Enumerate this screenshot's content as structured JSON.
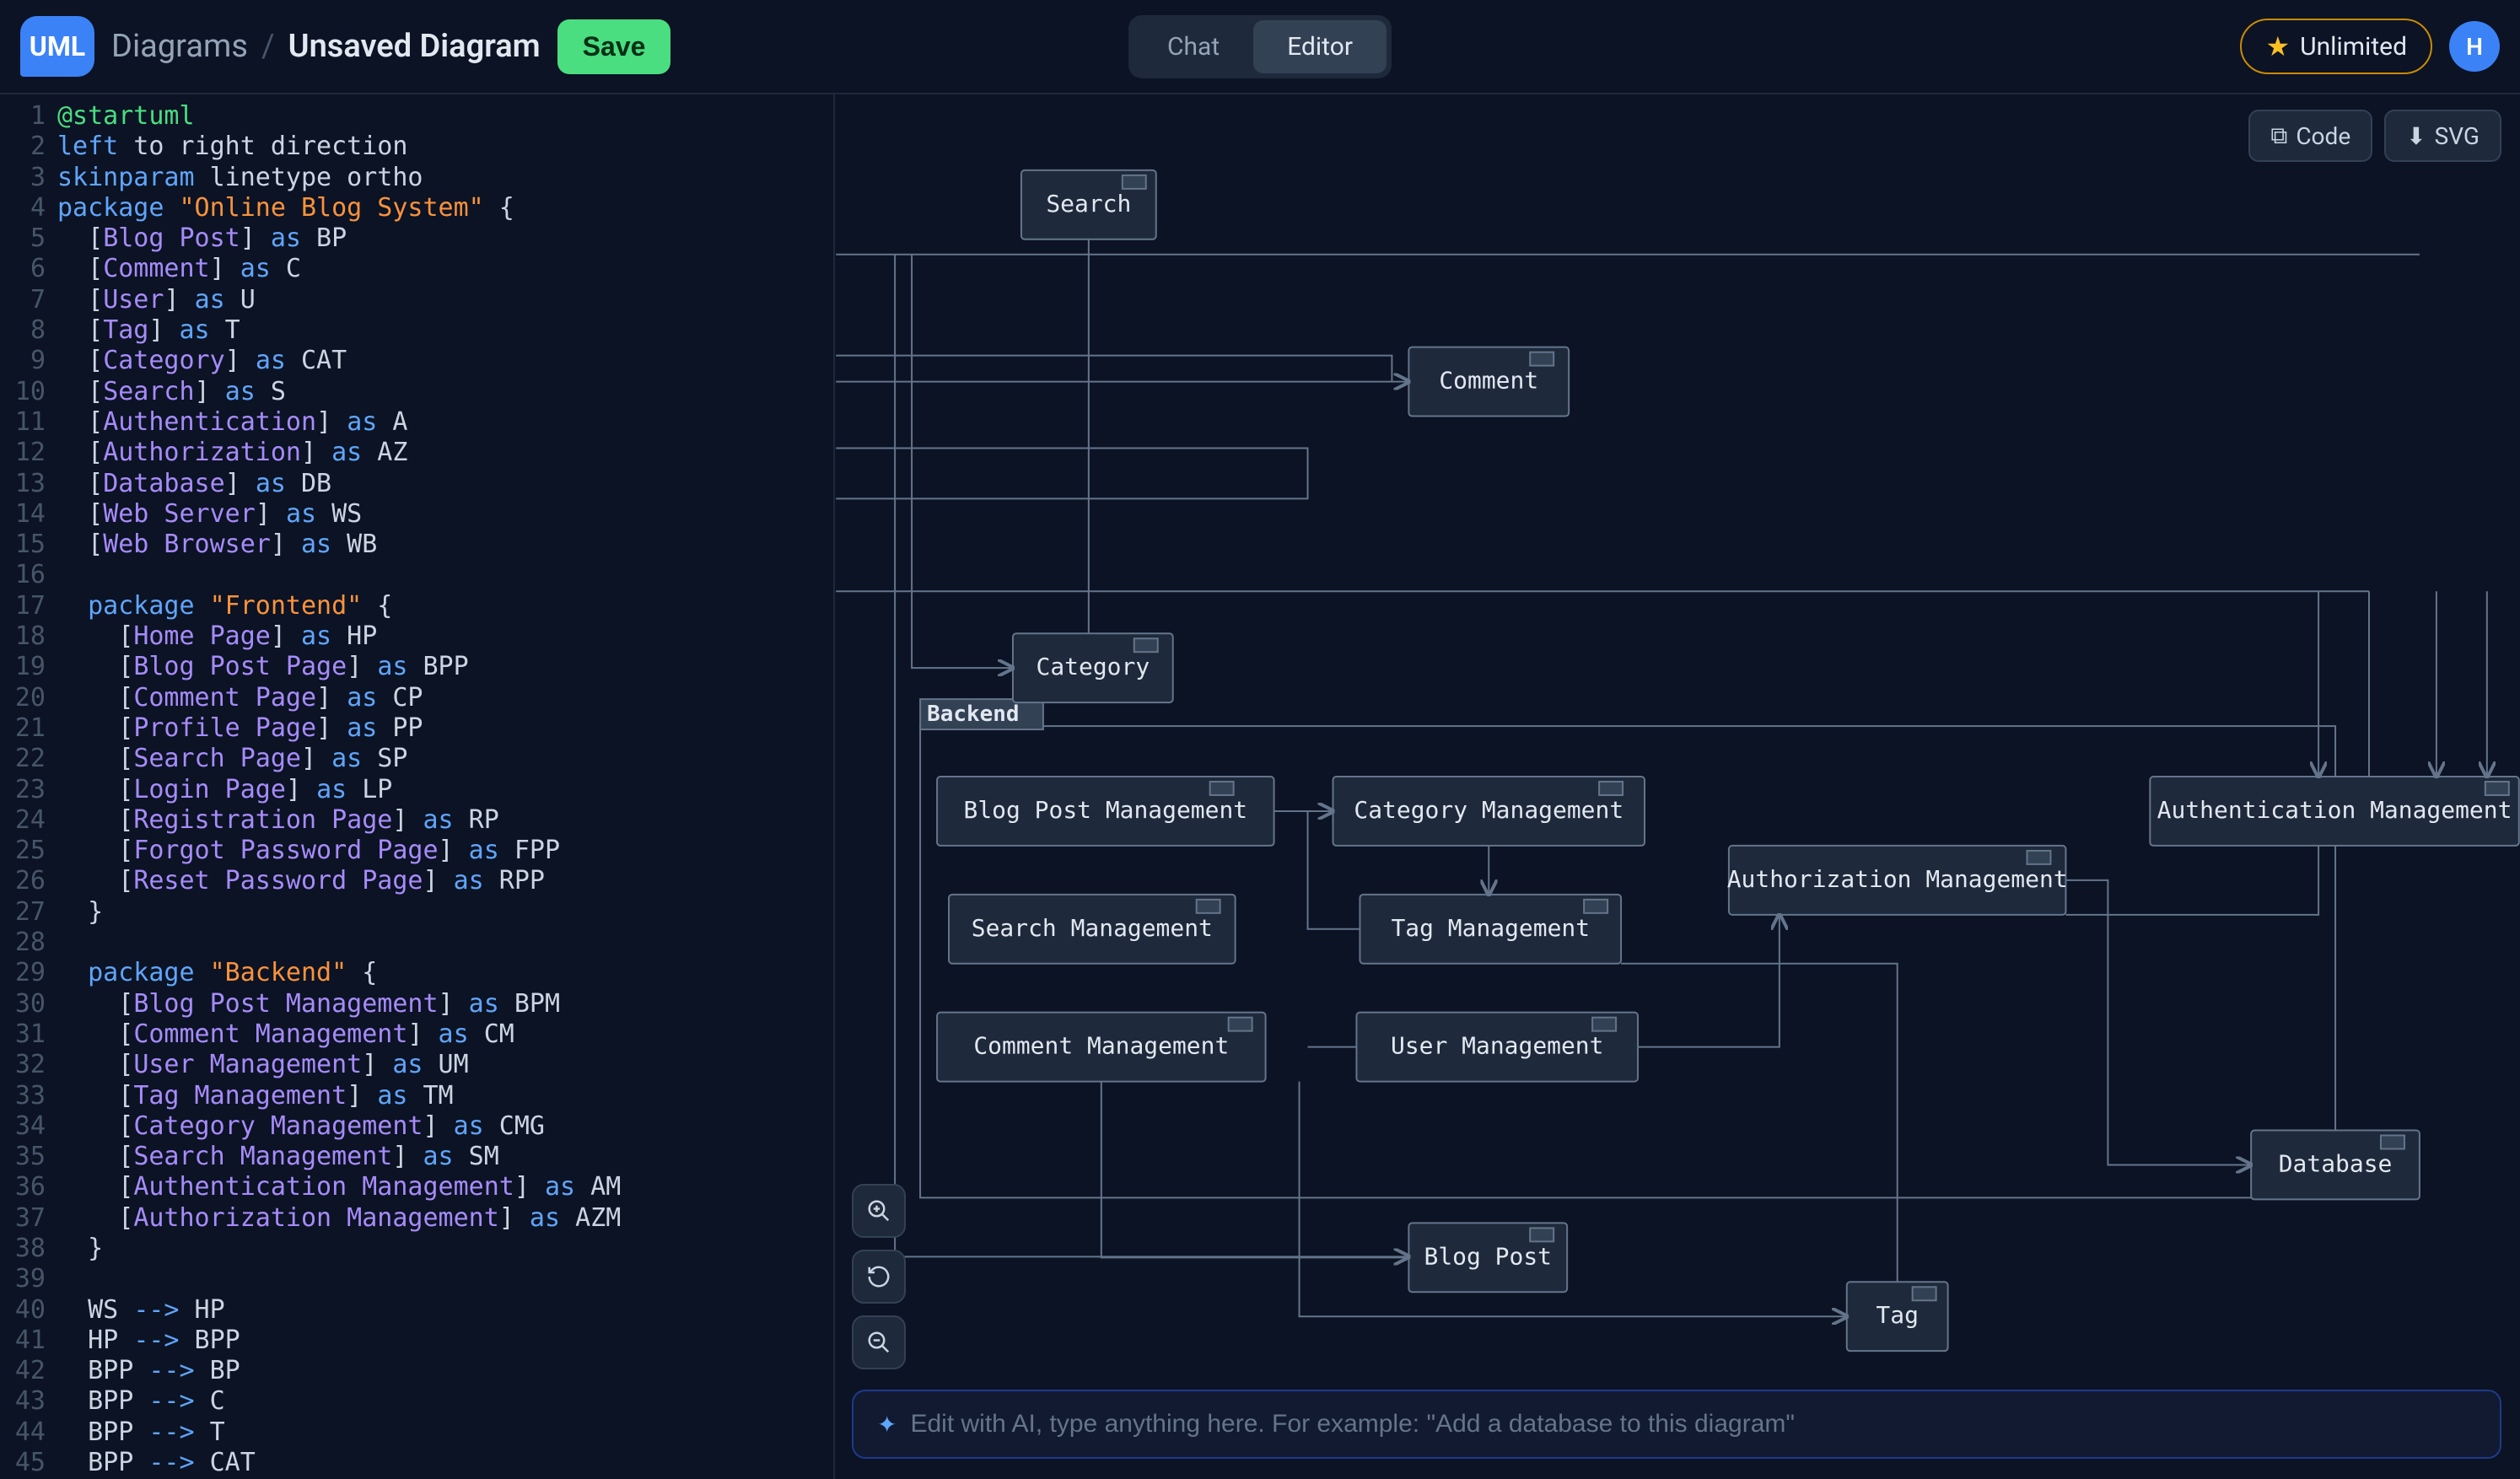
{
  "header": {
    "logo_text": "UML",
    "breadcrumb_root": "Diagrams",
    "breadcrumb_sep": "/",
    "breadcrumb_current": "Unsaved Diagram",
    "save_label": "Save",
    "tabs": {
      "chat": "Chat",
      "editor": "Editor"
    },
    "unlimited_label": "Unlimited",
    "avatar_initial": "H"
  },
  "toolbar": {
    "code": "Code",
    "svg": "SVG"
  },
  "ai_placeholder": "Edit with AI, type anything here. For example: \"Add a database to this diagram\"",
  "diagram": {
    "backend_label": "Backend",
    "nodes": {
      "search": "Search",
      "comment": "Comment",
      "category": "Category",
      "bpm": "Blog Post Management",
      "cmg": "Category Management",
      "am": "Authentication Management",
      "azm": "Authorization Management",
      "sm": "Search Management",
      "tm": "Tag Management",
      "cm": "Comment Management",
      "um": "User Management",
      "db": "Database",
      "bp": "Blog Post",
      "tag": "Tag"
    }
  },
  "code_lines": [
    {
      "n": 1,
      "seg": [
        {
          "t": "@startuml",
          "c": "kw-green"
        }
      ]
    },
    {
      "n": 2,
      "seg": [
        {
          "t": "left ",
          "c": "kw-blue"
        },
        {
          "t": "to right direction",
          "c": ""
        }
      ]
    },
    {
      "n": 3,
      "seg": [
        {
          "t": "skinparam ",
          "c": "kw-blue"
        },
        {
          "t": "linetype ortho",
          "c": ""
        }
      ]
    },
    {
      "n": 4,
      "seg": [
        {
          "t": "package ",
          "c": "kw-blue"
        },
        {
          "t": "\"Online Blog System\"",
          "c": "str-orange"
        },
        {
          "t": " {",
          "c": ""
        }
      ]
    },
    {
      "n": 5,
      "seg": [
        {
          "t": "  [",
          "c": ""
        },
        {
          "t": "Blog Post",
          "c": "kw-violet"
        },
        {
          "t": "] ",
          "c": ""
        },
        {
          "t": "as",
          "c": "kw-blue"
        },
        {
          "t": " BP",
          "c": ""
        }
      ]
    },
    {
      "n": 6,
      "seg": [
        {
          "t": "  [",
          "c": ""
        },
        {
          "t": "Comment",
          "c": "kw-violet"
        },
        {
          "t": "] ",
          "c": ""
        },
        {
          "t": "as",
          "c": "kw-blue"
        },
        {
          "t": " C",
          "c": ""
        }
      ]
    },
    {
      "n": 7,
      "seg": [
        {
          "t": "  [",
          "c": ""
        },
        {
          "t": "User",
          "c": "kw-violet"
        },
        {
          "t": "] ",
          "c": ""
        },
        {
          "t": "as",
          "c": "kw-blue"
        },
        {
          "t": " U",
          "c": ""
        }
      ]
    },
    {
      "n": 8,
      "seg": [
        {
          "t": "  [",
          "c": ""
        },
        {
          "t": "Tag",
          "c": "kw-violet"
        },
        {
          "t": "] ",
          "c": ""
        },
        {
          "t": "as",
          "c": "kw-blue"
        },
        {
          "t": " T",
          "c": ""
        }
      ]
    },
    {
      "n": 9,
      "seg": [
        {
          "t": "  [",
          "c": ""
        },
        {
          "t": "Category",
          "c": "kw-violet"
        },
        {
          "t": "] ",
          "c": ""
        },
        {
          "t": "as",
          "c": "kw-blue"
        },
        {
          "t": " CAT",
          "c": ""
        }
      ]
    },
    {
      "n": 10,
      "seg": [
        {
          "t": "  [",
          "c": ""
        },
        {
          "t": "Search",
          "c": "kw-violet"
        },
        {
          "t": "] ",
          "c": ""
        },
        {
          "t": "as",
          "c": "kw-blue"
        },
        {
          "t": " S",
          "c": ""
        }
      ]
    },
    {
      "n": 11,
      "seg": [
        {
          "t": "  [",
          "c": ""
        },
        {
          "t": "Authentication",
          "c": "kw-violet"
        },
        {
          "t": "] ",
          "c": ""
        },
        {
          "t": "as",
          "c": "kw-blue"
        },
        {
          "t": " A",
          "c": ""
        }
      ]
    },
    {
      "n": 12,
      "seg": [
        {
          "t": "  [",
          "c": ""
        },
        {
          "t": "Authorization",
          "c": "kw-violet"
        },
        {
          "t": "] ",
          "c": ""
        },
        {
          "t": "as",
          "c": "kw-blue"
        },
        {
          "t": " AZ",
          "c": ""
        }
      ]
    },
    {
      "n": 13,
      "seg": [
        {
          "t": "  [",
          "c": ""
        },
        {
          "t": "Database",
          "c": "kw-violet"
        },
        {
          "t": "] ",
          "c": ""
        },
        {
          "t": "as",
          "c": "kw-blue"
        },
        {
          "t": " DB",
          "c": ""
        }
      ]
    },
    {
      "n": 14,
      "seg": [
        {
          "t": "  [",
          "c": ""
        },
        {
          "t": "Web Server",
          "c": "kw-violet"
        },
        {
          "t": "] ",
          "c": ""
        },
        {
          "t": "as",
          "c": "kw-blue"
        },
        {
          "t": " WS",
          "c": ""
        }
      ]
    },
    {
      "n": 15,
      "seg": [
        {
          "t": "  [",
          "c": ""
        },
        {
          "t": "Web Browser",
          "c": "kw-violet"
        },
        {
          "t": "] ",
          "c": ""
        },
        {
          "t": "as",
          "c": "kw-blue"
        },
        {
          "t": " WB",
          "c": ""
        }
      ]
    },
    {
      "n": 16,
      "seg": [
        {
          "t": "",
          "c": ""
        }
      ]
    },
    {
      "n": 17,
      "seg": [
        {
          "t": "  ",
          "c": ""
        },
        {
          "t": "package ",
          "c": "kw-blue"
        },
        {
          "t": "\"Frontend\"",
          "c": "str-orange"
        },
        {
          "t": " {",
          "c": ""
        }
      ]
    },
    {
      "n": 18,
      "seg": [
        {
          "t": "    [",
          "c": ""
        },
        {
          "t": "Home Page",
          "c": "kw-violet"
        },
        {
          "t": "] ",
          "c": ""
        },
        {
          "t": "as",
          "c": "kw-blue"
        },
        {
          "t": " HP",
          "c": ""
        }
      ]
    },
    {
      "n": 19,
      "seg": [
        {
          "t": "    [",
          "c": ""
        },
        {
          "t": "Blog Post Page",
          "c": "kw-violet"
        },
        {
          "t": "] ",
          "c": ""
        },
        {
          "t": "as",
          "c": "kw-blue"
        },
        {
          "t": " BPP",
          "c": ""
        }
      ]
    },
    {
      "n": 20,
      "seg": [
        {
          "t": "    [",
          "c": ""
        },
        {
          "t": "Comment Page",
          "c": "kw-violet"
        },
        {
          "t": "] ",
          "c": ""
        },
        {
          "t": "as",
          "c": "kw-blue"
        },
        {
          "t": " CP",
          "c": ""
        }
      ]
    },
    {
      "n": 21,
      "seg": [
        {
          "t": "    [",
          "c": ""
        },
        {
          "t": "Profile Page",
          "c": "kw-violet"
        },
        {
          "t": "] ",
          "c": ""
        },
        {
          "t": "as",
          "c": "kw-blue"
        },
        {
          "t": " PP",
          "c": ""
        }
      ]
    },
    {
      "n": 22,
      "seg": [
        {
          "t": "    [",
          "c": ""
        },
        {
          "t": "Search Page",
          "c": "kw-violet"
        },
        {
          "t": "] ",
          "c": ""
        },
        {
          "t": "as",
          "c": "kw-blue"
        },
        {
          "t": " SP",
          "c": ""
        }
      ]
    },
    {
      "n": 23,
      "seg": [
        {
          "t": "    [",
          "c": ""
        },
        {
          "t": "Login Page",
          "c": "kw-violet"
        },
        {
          "t": "] ",
          "c": ""
        },
        {
          "t": "as",
          "c": "kw-blue"
        },
        {
          "t": " LP",
          "c": ""
        }
      ]
    },
    {
      "n": 24,
      "seg": [
        {
          "t": "    [",
          "c": ""
        },
        {
          "t": "Registration Page",
          "c": "kw-violet"
        },
        {
          "t": "] ",
          "c": ""
        },
        {
          "t": "as",
          "c": "kw-blue"
        },
        {
          "t": " RP",
          "c": ""
        }
      ]
    },
    {
      "n": 25,
      "seg": [
        {
          "t": "    [",
          "c": ""
        },
        {
          "t": "Forgot Password Page",
          "c": "kw-violet"
        },
        {
          "t": "] ",
          "c": ""
        },
        {
          "t": "as",
          "c": "kw-blue"
        },
        {
          "t": " FPP",
          "c": ""
        }
      ]
    },
    {
      "n": 26,
      "seg": [
        {
          "t": "    [",
          "c": ""
        },
        {
          "t": "Reset Password Page",
          "c": "kw-violet"
        },
        {
          "t": "] ",
          "c": ""
        },
        {
          "t": "as",
          "c": "kw-blue"
        },
        {
          "t": " RPP",
          "c": ""
        }
      ]
    },
    {
      "n": 27,
      "seg": [
        {
          "t": "  }",
          "c": ""
        }
      ]
    },
    {
      "n": 28,
      "seg": [
        {
          "t": "",
          "c": ""
        }
      ]
    },
    {
      "n": 29,
      "seg": [
        {
          "t": "  ",
          "c": ""
        },
        {
          "t": "package ",
          "c": "kw-blue"
        },
        {
          "t": "\"Backend\"",
          "c": "str-orange"
        },
        {
          "t": " {",
          "c": ""
        }
      ]
    },
    {
      "n": 30,
      "seg": [
        {
          "t": "    [",
          "c": ""
        },
        {
          "t": "Blog Post Management",
          "c": "kw-violet"
        },
        {
          "t": "] ",
          "c": ""
        },
        {
          "t": "as",
          "c": "kw-blue"
        },
        {
          "t": " BPM",
          "c": ""
        }
      ]
    },
    {
      "n": 31,
      "seg": [
        {
          "t": "    [",
          "c": ""
        },
        {
          "t": "Comment Management",
          "c": "kw-violet"
        },
        {
          "t": "] ",
          "c": ""
        },
        {
          "t": "as",
          "c": "kw-blue"
        },
        {
          "t": " CM",
          "c": ""
        }
      ]
    },
    {
      "n": 32,
      "seg": [
        {
          "t": "    [",
          "c": ""
        },
        {
          "t": "User Management",
          "c": "kw-violet"
        },
        {
          "t": "] ",
          "c": ""
        },
        {
          "t": "as",
          "c": "kw-blue"
        },
        {
          "t": " UM",
          "c": ""
        }
      ]
    },
    {
      "n": 33,
      "seg": [
        {
          "t": "    [",
          "c": ""
        },
        {
          "t": "Tag Management",
          "c": "kw-violet"
        },
        {
          "t": "] ",
          "c": ""
        },
        {
          "t": "as",
          "c": "kw-blue"
        },
        {
          "t": " TM",
          "c": ""
        }
      ]
    },
    {
      "n": 34,
      "seg": [
        {
          "t": "    [",
          "c": ""
        },
        {
          "t": "Category Management",
          "c": "kw-violet"
        },
        {
          "t": "] ",
          "c": ""
        },
        {
          "t": "as",
          "c": "kw-blue"
        },
        {
          "t": " CMG",
          "c": ""
        }
      ]
    },
    {
      "n": 35,
      "seg": [
        {
          "t": "    [",
          "c": ""
        },
        {
          "t": "Search Management",
          "c": "kw-violet"
        },
        {
          "t": "] ",
          "c": ""
        },
        {
          "t": "as",
          "c": "kw-blue"
        },
        {
          "t": " SM",
          "c": ""
        }
      ]
    },
    {
      "n": 36,
      "seg": [
        {
          "t": "    [",
          "c": ""
        },
        {
          "t": "Authentication Management",
          "c": "kw-violet"
        },
        {
          "t": "] ",
          "c": ""
        },
        {
          "t": "as",
          "c": "kw-blue"
        },
        {
          "t": " AM",
          "c": ""
        }
      ]
    },
    {
      "n": 37,
      "seg": [
        {
          "t": "    [",
          "c": ""
        },
        {
          "t": "Authorization Management",
          "c": "kw-violet"
        },
        {
          "t": "] ",
          "c": ""
        },
        {
          "t": "as",
          "c": "kw-blue"
        },
        {
          "t": " AZM",
          "c": ""
        }
      ]
    },
    {
      "n": 38,
      "seg": [
        {
          "t": "  }",
          "c": ""
        }
      ]
    },
    {
      "n": 39,
      "seg": [
        {
          "t": "",
          "c": ""
        }
      ]
    },
    {
      "n": 40,
      "seg": [
        {
          "t": "  WS ",
          "c": ""
        },
        {
          "t": "-->",
          "c": "kw-blue"
        },
        {
          "t": " HP",
          "c": ""
        }
      ]
    },
    {
      "n": 41,
      "seg": [
        {
          "t": "  HP ",
          "c": ""
        },
        {
          "t": "-->",
          "c": "kw-blue"
        },
        {
          "t": " BPP",
          "c": ""
        }
      ]
    },
    {
      "n": 42,
      "seg": [
        {
          "t": "  BPP ",
          "c": ""
        },
        {
          "t": "-->",
          "c": "kw-blue"
        },
        {
          "t": " BP",
          "c": ""
        }
      ]
    },
    {
      "n": 43,
      "seg": [
        {
          "t": "  BPP ",
          "c": ""
        },
        {
          "t": "-->",
          "c": "kw-blue"
        },
        {
          "t": " C",
          "c": ""
        }
      ]
    },
    {
      "n": 44,
      "seg": [
        {
          "t": "  BPP ",
          "c": ""
        },
        {
          "t": "-->",
          "c": "kw-blue"
        },
        {
          "t": " T",
          "c": ""
        }
      ]
    },
    {
      "n": 45,
      "seg": [
        {
          "t": "  BPP ",
          "c": ""
        },
        {
          "t": "-->",
          "c": "kw-blue"
        },
        {
          "t": " CAT",
          "c": ""
        }
      ]
    }
  ]
}
